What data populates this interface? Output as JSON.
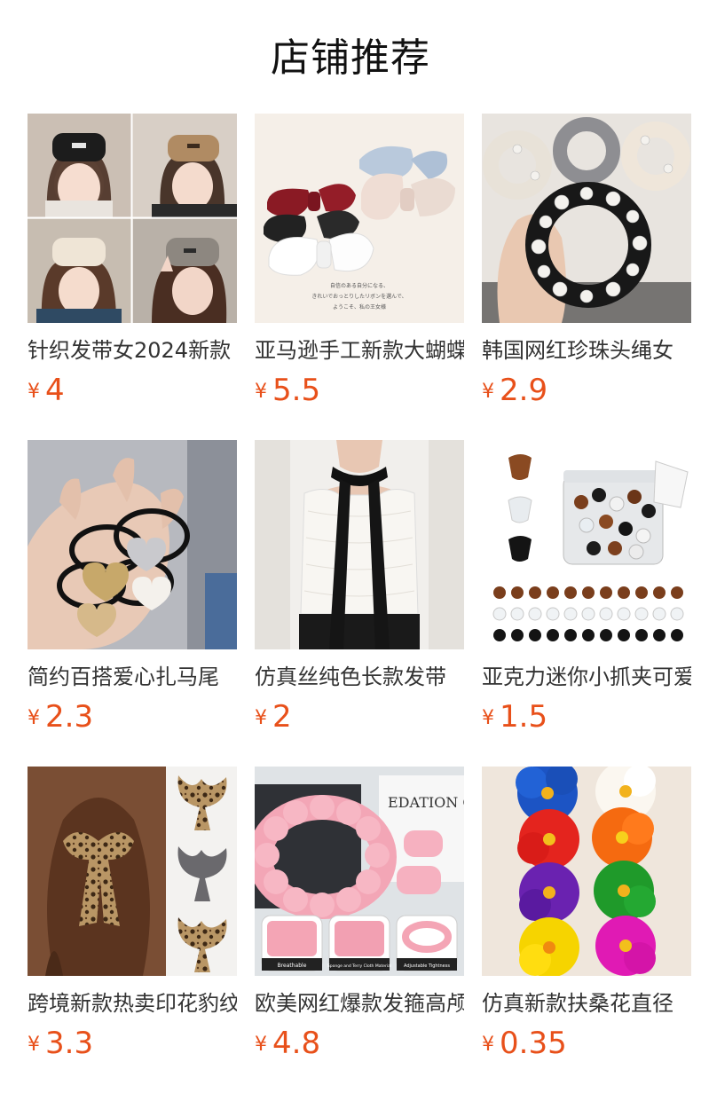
{
  "page": {
    "title": "店铺推荐"
  },
  "currency_symbol": "¥",
  "products": [
    {
      "name": "针织发带女2024新款",
      "price": "4",
      "image": "knit-headband-photo"
    },
    {
      "name": "亚马逊手工新款大蝴蝶结",
      "price": "5.5",
      "image": "bow-hairclip-photo"
    },
    {
      "name": "韩国网红珍珠头绳女",
      "price": "2.9",
      "image": "pearl-scrunchie-photo"
    },
    {
      "name": "简约百搭爱心扎马尾",
      "price": "2.3",
      "image": "heart-hair-tie-photo"
    },
    {
      "name": "仿真丝纯色长款发带",
      "price": "2",
      "image": "silk-long-ribbon-photo"
    },
    {
      "name": "亚克力迷你小抓夹可爱",
      "price": "1.5",
      "image": "mini-claw-clip-photo"
    },
    {
      "name": "跨境新款热卖印花豹纹",
      "price": "3.3",
      "image": "leopard-bow-photo"
    },
    {
      "name": "欧美网红爆款发箍高颅顶",
      "price": "4.8",
      "image": "spa-headband-photo"
    },
    {
      "name": "仿真新款扶桑花直径",
      "price": "0.35",
      "image": "hibiscus-flower-clip-photo"
    }
  ],
  "image_texts": {
    "bow_caption_1": "自信のある自分になる、",
    "bow_caption_2": "きれいでおっとりしたリボンを選んで、",
    "bow_caption_3": "ようこそ、私の王女様",
    "spa_label_1": "Breathable",
    "spa_label_2": "Sponge and Terry Cloth Material",
    "spa_label_3": "Adjustable Tightness",
    "spa_magazine": "EDATION CRAFT"
  }
}
